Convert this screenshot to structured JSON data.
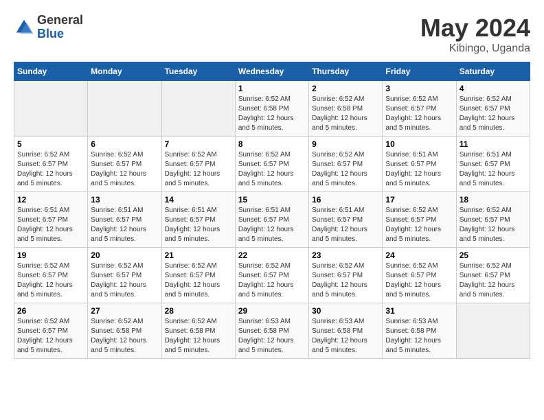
{
  "logo": {
    "general": "General",
    "blue": "Blue"
  },
  "title": {
    "month_year": "May 2024",
    "location": "Kibingo, Uganda"
  },
  "headers": [
    "Sunday",
    "Monday",
    "Tuesday",
    "Wednesday",
    "Thursday",
    "Friday",
    "Saturday"
  ],
  "weeks": [
    [
      {
        "day": "",
        "sunrise": "",
        "sunset": "",
        "daylight": "",
        "empty": true
      },
      {
        "day": "",
        "sunrise": "",
        "sunset": "",
        "daylight": "",
        "empty": true
      },
      {
        "day": "",
        "sunrise": "",
        "sunset": "",
        "daylight": "",
        "empty": true
      },
      {
        "day": "1",
        "sunrise": "Sunrise: 6:52 AM",
        "sunset": "Sunset: 6:58 PM",
        "daylight": "Daylight: 12 hours and 5 minutes.",
        "empty": false
      },
      {
        "day": "2",
        "sunrise": "Sunrise: 6:52 AM",
        "sunset": "Sunset: 6:58 PM",
        "daylight": "Daylight: 12 hours and 5 minutes.",
        "empty": false
      },
      {
        "day": "3",
        "sunrise": "Sunrise: 6:52 AM",
        "sunset": "Sunset: 6:57 PM",
        "daylight": "Daylight: 12 hours and 5 minutes.",
        "empty": false
      },
      {
        "day": "4",
        "sunrise": "Sunrise: 6:52 AM",
        "sunset": "Sunset: 6:57 PM",
        "daylight": "Daylight: 12 hours and 5 minutes.",
        "empty": false
      }
    ],
    [
      {
        "day": "5",
        "sunrise": "Sunrise: 6:52 AM",
        "sunset": "Sunset: 6:57 PM",
        "daylight": "Daylight: 12 hours and 5 minutes.",
        "empty": false
      },
      {
        "day": "6",
        "sunrise": "Sunrise: 6:52 AM",
        "sunset": "Sunset: 6:57 PM",
        "daylight": "Daylight: 12 hours and 5 minutes.",
        "empty": false
      },
      {
        "day": "7",
        "sunrise": "Sunrise: 6:52 AM",
        "sunset": "Sunset: 6:57 PM",
        "daylight": "Daylight: 12 hours and 5 minutes.",
        "empty": false
      },
      {
        "day": "8",
        "sunrise": "Sunrise: 6:52 AM",
        "sunset": "Sunset: 6:57 PM",
        "daylight": "Daylight: 12 hours and 5 minutes.",
        "empty": false
      },
      {
        "day": "9",
        "sunrise": "Sunrise: 6:52 AM",
        "sunset": "Sunset: 6:57 PM",
        "daylight": "Daylight: 12 hours and 5 minutes.",
        "empty": false
      },
      {
        "day": "10",
        "sunrise": "Sunrise: 6:51 AM",
        "sunset": "Sunset: 6:57 PM",
        "daylight": "Daylight: 12 hours and 5 minutes.",
        "empty": false
      },
      {
        "day": "11",
        "sunrise": "Sunrise: 6:51 AM",
        "sunset": "Sunset: 6:57 PM",
        "daylight": "Daylight: 12 hours and 5 minutes.",
        "empty": false
      }
    ],
    [
      {
        "day": "12",
        "sunrise": "Sunrise: 6:51 AM",
        "sunset": "Sunset: 6:57 PM",
        "daylight": "Daylight: 12 hours and 5 minutes.",
        "empty": false
      },
      {
        "day": "13",
        "sunrise": "Sunrise: 6:51 AM",
        "sunset": "Sunset: 6:57 PM",
        "daylight": "Daylight: 12 hours and 5 minutes.",
        "empty": false
      },
      {
        "day": "14",
        "sunrise": "Sunrise: 6:51 AM",
        "sunset": "Sunset: 6:57 PM",
        "daylight": "Daylight: 12 hours and 5 minutes.",
        "empty": false
      },
      {
        "day": "15",
        "sunrise": "Sunrise: 6:51 AM",
        "sunset": "Sunset: 6:57 PM",
        "daylight": "Daylight: 12 hours and 5 minutes.",
        "empty": false
      },
      {
        "day": "16",
        "sunrise": "Sunrise: 6:51 AM",
        "sunset": "Sunset: 6:57 PM",
        "daylight": "Daylight: 12 hours and 5 minutes.",
        "empty": false
      },
      {
        "day": "17",
        "sunrise": "Sunrise: 6:52 AM",
        "sunset": "Sunset: 6:57 PM",
        "daylight": "Daylight: 12 hours and 5 minutes.",
        "empty": false
      },
      {
        "day": "18",
        "sunrise": "Sunrise: 6:52 AM",
        "sunset": "Sunset: 6:57 PM",
        "daylight": "Daylight: 12 hours and 5 minutes.",
        "empty": false
      }
    ],
    [
      {
        "day": "19",
        "sunrise": "Sunrise: 6:52 AM",
        "sunset": "Sunset: 6:57 PM",
        "daylight": "Daylight: 12 hours and 5 minutes.",
        "empty": false
      },
      {
        "day": "20",
        "sunrise": "Sunrise: 6:52 AM",
        "sunset": "Sunset: 6:57 PM",
        "daylight": "Daylight: 12 hours and 5 minutes.",
        "empty": false
      },
      {
        "day": "21",
        "sunrise": "Sunrise: 6:52 AM",
        "sunset": "Sunset: 6:57 PM",
        "daylight": "Daylight: 12 hours and 5 minutes.",
        "empty": false
      },
      {
        "day": "22",
        "sunrise": "Sunrise: 6:52 AM",
        "sunset": "Sunset: 6:57 PM",
        "daylight": "Daylight: 12 hours and 5 minutes.",
        "empty": false
      },
      {
        "day": "23",
        "sunrise": "Sunrise: 6:52 AM",
        "sunset": "Sunset: 6:57 PM",
        "daylight": "Daylight: 12 hours and 5 minutes.",
        "empty": false
      },
      {
        "day": "24",
        "sunrise": "Sunrise: 6:52 AM",
        "sunset": "Sunset: 6:57 PM",
        "daylight": "Daylight: 12 hours and 5 minutes.",
        "empty": false
      },
      {
        "day": "25",
        "sunrise": "Sunrise: 6:52 AM",
        "sunset": "Sunset: 6:57 PM",
        "daylight": "Daylight: 12 hours and 5 minutes.",
        "empty": false
      }
    ],
    [
      {
        "day": "26",
        "sunrise": "Sunrise: 6:52 AM",
        "sunset": "Sunset: 6:57 PM",
        "daylight": "Daylight: 12 hours and 5 minutes.",
        "empty": false
      },
      {
        "day": "27",
        "sunrise": "Sunrise: 6:52 AM",
        "sunset": "Sunset: 6:58 PM",
        "daylight": "Daylight: 12 hours and 5 minutes.",
        "empty": false
      },
      {
        "day": "28",
        "sunrise": "Sunrise: 6:52 AM",
        "sunset": "Sunset: 6:58 PM",
        "daylight": "Daylight: 12 hours and 5 minutes.",
        "empty": false
      },
      {
        "day": "29",
        "sunrise": "Sunrise: 6:53 AM",
        "sunset": "Sunset: 6:58 PM",
        "daylight": "Daylight: 12 hours and 5 minutes.",
        "empty": false
      },
      {
        "day": "30",
        "sunrise": "Sunrise: 6:53 AM",
        "sunset": "Sunset: 6:58 PM",
        "daylight": "Daylight: 12 hours and 5 minutes.",
        "empty": false
      },
      {
        "day": "31",
        "sunrise": "Sunrise: 6:53 AM",
        "sunset": "Sunset: 6:58 PM",
        "daylight": "Daylight: 12 hours and 5 minutes.",
        "empty": false
      },
      {
        "day": "",
        "sunrise": "",
        "sunset": "",
        "daylight": "",
        "empty": true
      }
    ]
  ]
}
